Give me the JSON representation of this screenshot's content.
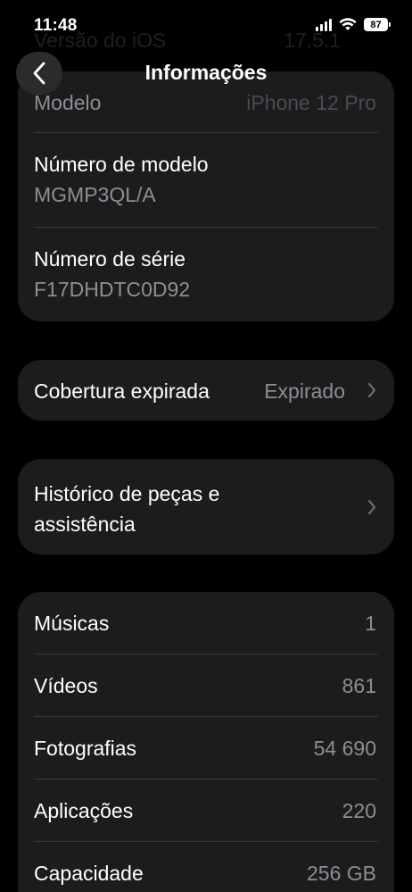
{
  "status_bar": {
    "time": "11:48",
    "battery": "87"
  },
  "ghost": {
    "label": "Versão do iOS",
    "value": "17.5.1"
  },
  "nav": {
    "title": "Informações"
  },
  "device_info": {
    "model_label": "Modelo",
    "model_value": "iPhone 12 Pro",
    "model_number_label": "Número de modelo",
    "model_number_value": "MGMP3QL/A",
    "serial_label": "Número de série",
    "serial_value": "F17DHDTC0D92"
  },
  "coverage": {
    "label": "Cobertura expirada",
    "value": "Expirado"
  },
  "history": {
    "label": "Histórico de peças e assistência"
  },
  "stats": [
    {
      "label": "Músicas",
      "value": "1"
    },
    {
      "label": "Vídeos",
      "value": "861"
    },
    {
      "label": "Fotografias",
      "value": "54 690"
    },
    {
      "label": "Aplicações",
      "value": "220"
    },
    {
      "label": "Capacidade",
      "value": "256 GB"
    }
  ]
}
